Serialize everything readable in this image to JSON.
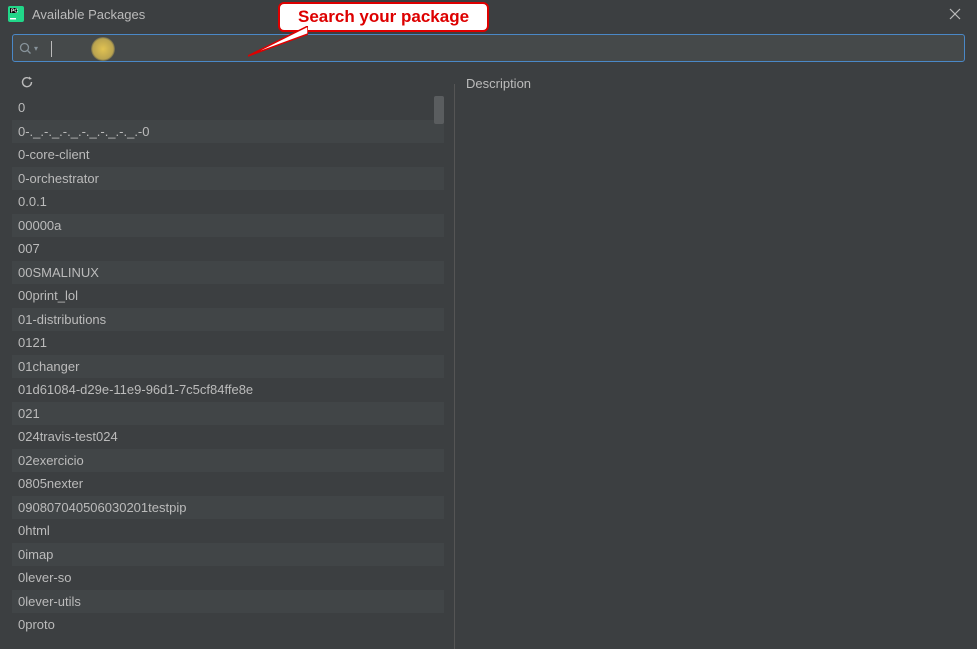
{
  "window": {
    "title": "Available Packages"
  },
  "search": {
    "value": "",
    "placeholder": ""
  },
  "callout": {
    "text": "Search your package"
  },
  "description": {
    "label": "Description"
  },
  "packages": [
    "0",
    "0-._.-._.-._.-._.-._.-._.-0",
    "0-core-client",
    "0-orchestrator",
    "0.0.1",
    "00000a",
    "007",
    "00SMALINUX",
    "00print_lol",
    "01-distributions",
    "0121",
    "01changer",
    "01d61084-d29e-11e9-96d1-7c5cf84ffe8e",
    "021",
    "024travis-test024",
    "02exercicio",
    "0805nexter",
    "090807040506030201testpip",
    "0html",
    "0imap",
    "0lever-so",
    "0lever-utils",
    "0proto"
  ]
}
